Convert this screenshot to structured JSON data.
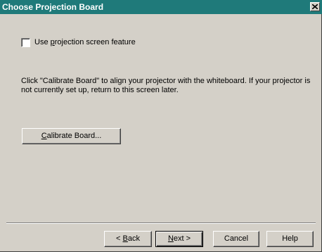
{
  "window": {
    "title": "Choose Projection Board"
  },
  "option": {
    "checkbox_label_pre": "Use ",
    "checkbox_label_accel": "p",
    "checkbox_label_post": "rojection screen feature",
    "checked": false
  },
  "instructions": "Click \"Calibrate Board\" to align your projector with the whiteboard. If your projector is not currently set up, return to this screen later.",
  "calibrate": {
    "accel": "C",
    "rest": "alibrate Board..."
  },
  "footer": {
    "back_pre": "< ",
    "back_accel": "B",
    "back_post": "ack",
    "next_accel": "N",
    "next_post": "ext >",
    "cancel": "Cancel",
    "help": "Help"
  },
  "colors": {
    "titlebar": "#1f7a7a",
    "face": "#d4d0c8"
  },
  "icons": {
    "close": "close-icon"
  }
}
